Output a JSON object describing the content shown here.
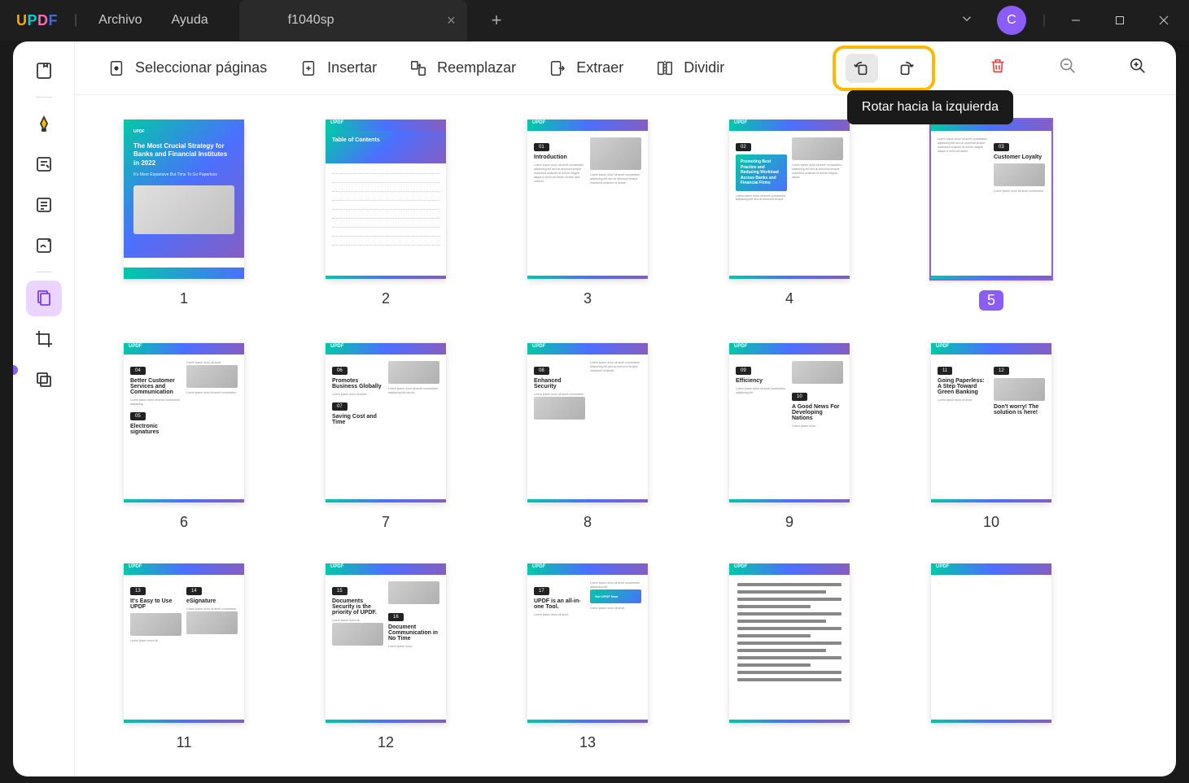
{
  "app": {
    "logo": "UPDF"
  },
  "menu": {
    "file": "Archivo",
    "help": "Ayuda"
  },
  "tab": {
    "title": "f1040sp",
    "close": "×",
    "add": "+"
  },
  "header": {
    "chevron": "⌄",
    "avatar": "C"
  },
  "toolbar": {
    "select": "Seleccionar páginas",
    "insert": "Insertar",
    "replace": "Reemplazar",
    "extract": "Extraer",
    "split": "Dividir"
  },
  "tooltip": {
    "rotate_left": "Rotar hacia la izquierda"
  },
  "pages": [
    {
      "num": "1",
      "selected": false
    },
    {
      "num": "2",
      "selected": false
    },
    {
      "num": "3",
      "selected": false
    },
    {
      "num": "4",
      "selected": false
    },
    {
      "num": "5",
      "selected": true
    },
    {
      "num": "6",
      "selected": false
    },
    {
      "num": "7",
      "selected": false
    },
    {
      "num": "8",
      "selected": false
    },
    {
      "num": "9",
      "selected": false
    },
    {
      "num": "10",
      "selected": false
    },
    {
      "num": "11",
      "selected": false
    },
    {
      "num": "12",
      "selected": false
    },
    {
      "num": "13",
      "selected": false
    }
  ],
  "thumbs": {
    "p1": {
      "title": "The Most Crucial Strategy for Banks and Financial Institutes in 2022",
      "sub": "It's More Expansive But Time To Go Paperless"
    },
    "p2": {
      "title": "Table of Contents"
    },
    "p3": {
      "badge": "01",
      "title": "Introduction"
    },
    "p4": {
      "badge": "02",
      "title": "Promoting Best Practice and Reducing Workload Across Banks and Financial Firms"
    },
    "p5": {
      "badge": "03",
      "title": "Customer Loyalty"
    },
    "p6": {
      "badge1": "04",
      "title1": "Better Customer Services and Communication",
      "badge2": "05",
      "title2": "Electronic signatures"
    },
    "p7": {
      "badge1": "06",
      "title1": "Promotes Business Globally",
      "badge2": "07",
      "title2": "Saving Cost and Time"
    },
    "p8": {
      "badge": "08",
      "title": "Enhanced Security"
    },
    "p9": {
      "badge1": "09",
      "title1": "Efficiency",
      "badge2": "10",
      "title2": "A Good News For Developing Nations"
    },
    "p10": {
      "badge1": "11",
      "title1": "Going Paperless: A Step Toward Green Banking",
      "badge2": "12",
      "title2": "Don't worry! The solution is here!"
    },
    "p11": {
      "badge1": "13",
      "title1": "It's Easy to Use UPDF",
      "badge2": "14",
      "title2": "eSignature"
    },
    "p12": {
      "badge1": "15",
      "title1": "Documents Security is the priority of UPDF.",
      "badge2": "16",
      "title2": "Document Communication in No Time"
    },
    "p13": {
      "badge": "17",
      "title": "UPDF is an all-in-one Tool."
    }
  }
}
